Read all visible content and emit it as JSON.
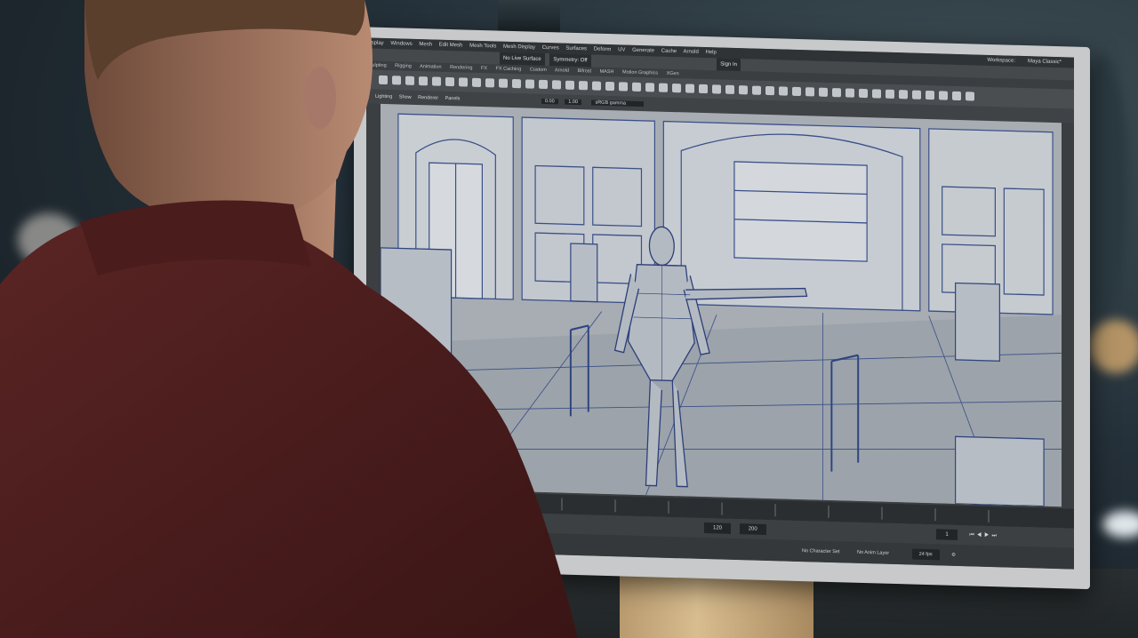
{
  "app": {
    "menus": [
      "Display",
      "Windows",
      "Mesh",
      "Edit Mesh",
      "Mesh Tools",
      "Mesh Display",
      "Curves",
      "Surfaces",
      "Deform",
      "UV",
      "Generate",
      "Cache",
      "Arnold",
      "Help"
    ],
    "workspace_label": "Workspace:",
    "workspace_value": "Maya Classic*",
    "toolbar": {
      "live_surface": "No Live Surface",
      "symmetry": "Symmetry: Off",
      "sign_in": "Sign In"
    },
    "shelf_tabs": [
      "Sculpting",
      "Rigging",
      "Animation",
      "Rendering",
      "FX",
      "FX Caching",
      "Custom",
      "Arnold",
      "Bifrost",
      "MASH",
      "Motion Graphics",
      "XGen"
    ],
    "panel_menus": [
      "Lighting",
      "Show",
      "Renderer",
      "Panels"
    ],
    "panel_values": [
      "0.00",
      "1.00"
    ],
    "color_space": "sRGB gamma",
    "range": {
      "start": "120",
      "end": "200",
      "current": "1"
    },
    "status": {
      "character_set": "No Character Set",
      "anim_layer": "No Anim Layer",
      "fps": "24 fps"
    }
  },
  "colors": {
    "shirt": "#4a1c1c",
    "viewport_bg": "#a7adb3",
    "wireframe": "#2b3f7a",
    "monitor_bezel": "#c7c9ca",
    "stand_wood": "#c9ab7c"
  },
  "icons": [
    "polygon-primitive-icon",
    "select-tool-icon",
    "play-forward-icon",
    "settings-icon"
  ]
}
